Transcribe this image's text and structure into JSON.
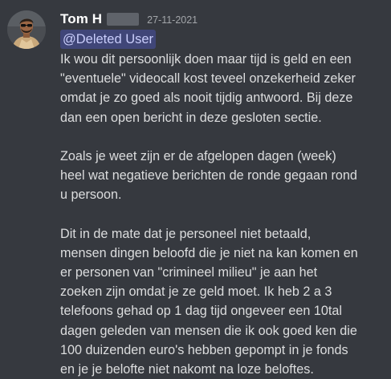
{
  "message": {
    "author": "Tom H",
    "timestamp": "27-11-2021",
    "mention": "@Deleted User",
    "avatar_icon": "user-avatar-photo",
    "paragraphs": [
      [
        "Ik wou dit persoonlijk doen maar tijd is geld en een",
        "\"eventuele\" videocall kost teveel onzekerheid zeker",
        "omdat je zo goed als nooit tijdig antwoord. Bij deze",
        "dan een open bericht in deze gesloten sectie."
      ],
      [
        "Zoals je weet zijn er de afgelopen dagen (week)",
        "heel wat negatieve berichten de ronde gegaan rond",
        "u persoon."
      ],
      [
        "Dit in de mate dat je personeel niet betaald,",
        "mensen dingen beloofd die je niet na kan komen en",
        "er personen van \"crimineel milieu\"  je aan het",
        "zoeken zijn omdat je ze geld moet. Ik heb 2 a 3",
        "telefoons gehad op 1 dag tijd ongeveer een 10tal",
        "dagen geleden van mensen die ik ook goed ken die",
        "100 duizenden euro's  hebben gepompt in je fonds",
        "en je je belofte niet nakomt na loze beloftes."
      ]
    ]
  },
  "colors": {
    "background": "#36393f",
    "text": "#dcddde",
    "username": "#ffffff",
    "timestamp": "#a3a6aa",
    "mention_text": "#c9cdfb",
    "mention_bg": "#5865f2"
  }
}
